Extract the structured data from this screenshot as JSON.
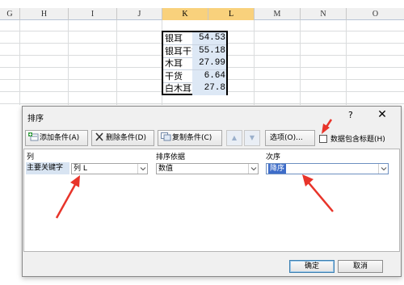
{
  "sheet": {
    "columns": [
      "G",
      "H",
      "I",
      "J",
      "K",
      "L",
      "M",
      "N",
      "O"
    ],
    "selected_columns": [
      "K",
      "L"
    ],
    "rows": [
      {
        "label": "银耳",
        "value": "54.53"
      },
      {
        "label": "银耳干货",
        "value": "55.18"
      },
      {
        "label": "木耳",
        "value": "27.99"
      },
      {
        "label": "干货",
        "value": "6.64"
      },
      {
        "label": "白木耳",
        "value": "27.8"
      }
    ]
  },
  "dialog": {
    "title": "排序",
    "help": "?",
    "close": "✕",
    "toolbar": {
      "add_level": "添加条件(A)",
      "delete_level": "删除条件(D)",
      "copy_level": "复制条件(C)",
      "move_up": "▲",
      "move_down": "▼",
      "options": "选项(O)..."
    },
    "header_checkbox": {
      "label": "数据包含标题(H)",
      "checked": false
    },
    "grid": {
      "col_column": "列",
      "col_sort_on": "排序依据",
      "col_order": "次序",
      "row": {
        "label": "主要关键字",
        "column_value": "列 L",
        "sort_on_value": "数值",
        "order_value": "降序"
      }
    },
    "ok": "确定",
    "cancel": "取消"
  },
  "colors": {
    "selected_header": "#f9d17c",
    "selection_highlight": "#3d6cc9",
    "annotation": "#e8342a"
  },
  "icons": [
    "add-level-icon",
    "delete-level-icon",
    "copy-level-icon",
    "close-icon"
  ]
}
